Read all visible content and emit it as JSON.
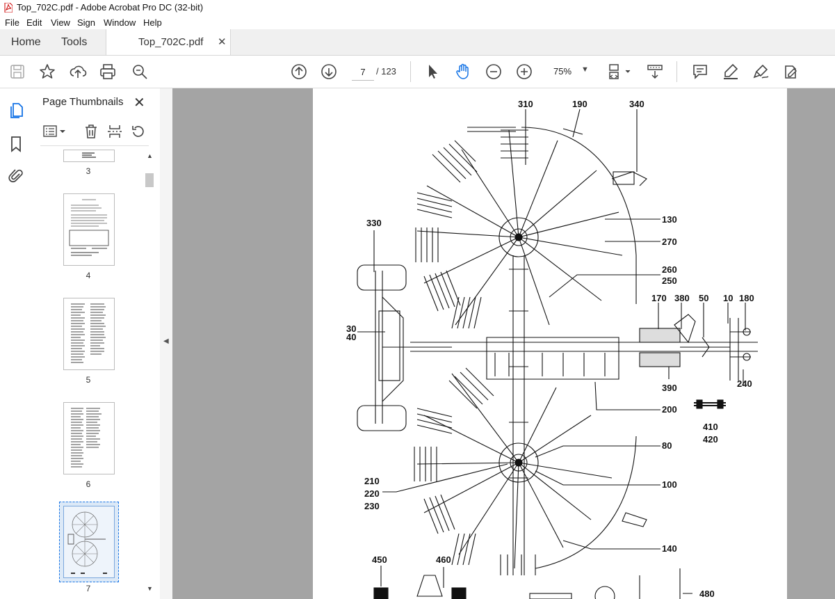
{
  "window": {
    "title": "Top_702C.pdf - Adobe Acrobat Pro DC (32-bit)"
  },
  "menu": [
    "File",
    "Edit",
    "View",
    "Sign",
    "Window",
    "Help"
  ],
  "tabs": {
    "home": "Home",
    "tools": "Tools",
    "document": "Top_702C.pdf",
    "document_close": "✕"
  },
  "toolbar": {
    "page_current": "7",
    "page_total": "/ 123",
    "zoom": "75%",
    "tools": [
      "save-icon",
      "bookmark-star-icon",
      "upload-icon",
      "print-icon",
      "search-zoom-icon",
      "prev-page-icon",
      "next-page-icon",
      "select-arrow-icon",
      "hand-icon",
      "zoom-out-icon",
      "zoom-in-icon",
      "page-fit-icon",
      "scroll-mode-icon",
      "comment-icon",
      "highlight-icon",
      "draw-icon",
      "fill-sign-icon"
    ]
  },
  "leftrail": [
    "page-thumbnails-icon",
    "bookmarks-icon",
    "attachments-icon"
  ],
  "thumbnails": {
    "title": "Page Thumbnails",
    "close": "✕",
    "pages": [
      "3",
      "4",
      "5",
      "6",
      "7"
    ],
    "selected": "7"
  },
  "drawing_labels": {
    "l310": "310",
    "l190": "190",
    "l340": "340",
    "l130": "130",
    "l270": "270",
    "l260": "260",
    "l250": "250",
    "l330": "330",
    "l30": "30",
    "l40": "40",
    "l170": "170",
    "l380": "380",
    "l50": "50",
    "l10": "10",
    "l180": "180",
    "l390": "390",
    "l240": "240",
    "l200": "200",
    "l410": "410",
    "l420": "420",
    "l80": "80",
    "l100": "100",
    "l210": "210",
    "l220": "220",
    "l230": "230",
    "l140": "140",
    "l450": "450",
    "l460": "460",
    "l480": "480"
  },
  "colors": {
    "accent": "#1473e6",
    "doc_background": "#a4a4a4",
    "selected_thumb": "#dce9f7"
  }
}
